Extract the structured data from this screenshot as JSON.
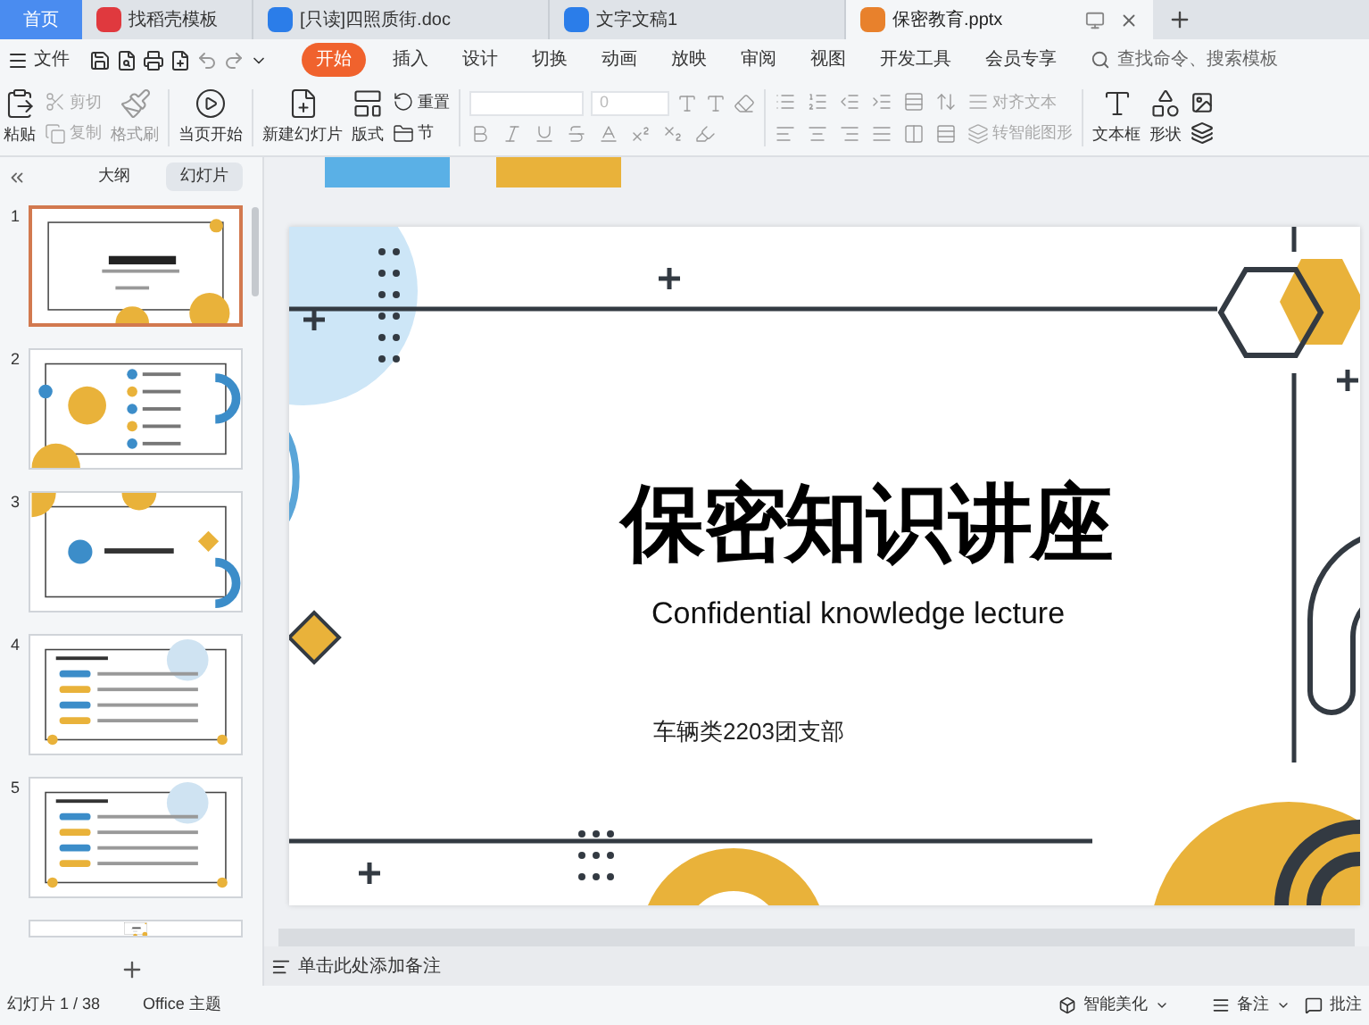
{
  "doc_tabs": [
    {
      "label": "首页",
      "kind": "home",
      "selected": false
    },
    {
      "label": "找稻壳模板",
      "kind": "docer",
      "selected": false
    },
    {
      "label": "[只读]四照质街.doc",
      "kind": "word",
      "selected": false
    },
    {
      "label": "文字文稿1",
      "kind": "word",
      "selected": false
    },
    {
      "label": "保密教育.pptx",
      "kind": "ppt",
      "selected": true
    }
  ],
  "menu": {
    "file": "文件",
    "tabs": [
      {
        "label": "开始",
        "selected": true
      },
      {
        "label": "插入",
        "selected": false
      },
      {
        "label": "设计",
        "selected": false
      },
      {
        "label": "切换",
        "selected": false
      },
      {
        "label": "动画",
        "selected": false
      },
      {
        "label": "放映",
        "selected": false
      },
      {
        "label": "审阅",
        "selected": false
      },
      {
        "label": "视图",
        "selected": false
      },
      {
        "label": "开发工具",
        "selected": false
      },
      {
        "label": "会员专享",
        "selected": false
      }
    ],
    "search": {
      "placeholder": "查找命令、搜索模板"
    }
  },
  "ribbon": {
    "paste": "粘贴",
    "cut": "剪切",
    "copy": "复制",
    "format_painter": "格式刷",
    "play": "当页开始",
    "new_slide": "新建幻灯片",
    "layout": "版式",
    "reset": "重置",
    "section": "节",
    "font_size": "0",
    "align_text": "对齐文本",
    "smartart": "转智能图形",
    "textbox": "文本框",
    "shape": "形状"
  },
  "panel": {
    "tabs": [
      {
        "label": "大纲",
        "selected": false
      },
      {
        "label": "幻灯片",
        "selected": true
      }
    ],
    "slides": [
      {
        "number": "1",
        "selected": true,
        "kind": "title"
      },
      {
        "number": "2",
        "selected": false,
        "kind": "contents"
      },
      {
        "number": "3",
        "selected": false,
        "kind": "section"
      },
      {
        "number": "4",
        "selected": false,
        "kind": "list"
      },
      {
        "number": "5",
        "selected": false,
        "kind": "list"
      }
    ]
  },
  "slide": {
    "title": "保密知识讲座",
    "subtitle": "Confidential knowledge lecture",
    "organization": "车辆类2203团支部"
  },
  "notes": {
    "placeholder": "单击此处添加备注"
  },
  "status_bar": {
    "slide_count": "幻灯片 1 / 38",
    "theme": "Office 主题",
    "beautify": "智能美化",
    "notes": "备注",
    "comments": "批注"
  }
}
